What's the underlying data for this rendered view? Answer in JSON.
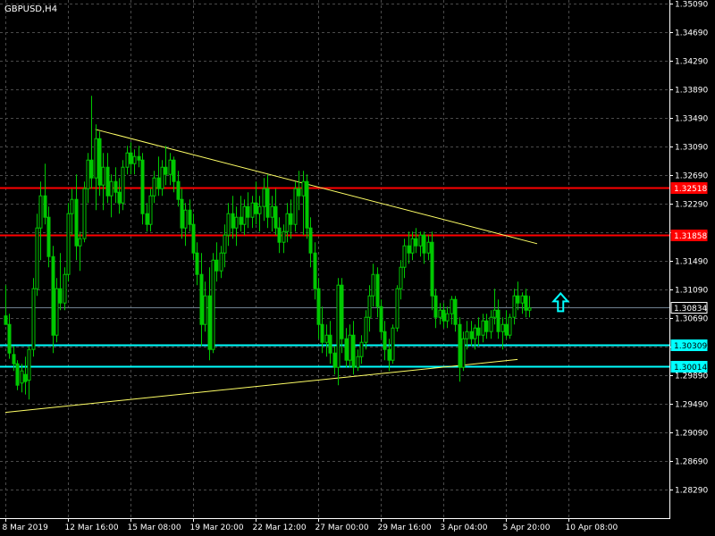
{
  "symbol_label": "GBPUSD,H4",
  "colors": {
    "background": "#000000",
    "grid": "#4a4a4a",
    "axis": "#ffffff",
    "candle": "#00c800",
    "resistance": "#ff0000",
    "support": "#00ffff",
    "trendline": "#ffff66",
    "current_price_line": "#708090"
  },
  "chart_data": {
    "type": "candlestick",
    "symbol": "GBPUSD",
    "timeframe": "H4",
    "title": "GBPUSD,H4",
    "ylim": [
      1.2809,
      1.3509
    ],
    "grid": true,
    "y_ticks": [
      "1.35090",
      "1.34690",
      "1.34290",
      "1.33890",
      "1.33490",
      "1.33090",
      "1.32690",
      "1.32290",
      "1.31890",
      "1.31490",
      "1.31090",
      "1.30690",
      "1.30290",
      "1.29890",
      "1.29490",
      "1.29090",
      "1.28690",
      "1.28290"
    ],
    "x_ticks": [
      "8 Mar 2019",
      "12 Mar 16:00",
      "15 Mar 08:00",
      "19 Mar 20:00",
      "22 Mar 12:00",
      "27 Mar 00:00",
      "29 Mar 16:00",
      "3 Apr 04:00",
      "5 Apr 20:00",
      "10 Apr 08:00"
    ],
    "x_range": [
      0,
      136
    ],
    "x_tick_index": [
      0,
      16,
      32,
      48,
      64,
      80,
      96,
      112,
      128,
      144
    ],
    "horizontal_levels": [
      {
        "name": "resistance-1",
        "price": 1.32518,
        "label": "1.32518",
        "color": "#ff0000"
      },
      {
        "name": "resistance-2",
        "price": 1.31858,
        "label": "1.31858",
        "color": "#ff0000"
      },
      {
        "name": "current-price",
        "price": 1.30834,
        "label": "1.30834",
        "color": "#708090"
      },
      {
        "name": "support-1",
        "price": 1.30309,
        "label": "1.30309",
        "color": "#00ffff"
      },
      {
        "name": "support-2",
        "price": 1.30014,
        "label": "1.30014",
        "color": "#00ffff"
      }
    ],
    "trendlines": [
      {
        "name": "descending-trendline",
        "from": [
          23,
          1.3333
        ],
        "to": [
          136,
          1.3173
        ]
      },
      {
        "name": "ascending-trendline",
        "from": [
          0,
          1.2937
        ],
        "to": [
          131,
          1.3011
        ]
      }
    ],
    "arrow": {
      "name": "up-arrow",
      "x": 142,
      "price": 1.3091,
      "direction": "up",
      "color": "#00ffff"
    },
    "candles": [
      [
        1.3072,
        1.3115,
        1.3065,
        1.306
      ],
      [
        1.306,
        1.3075,
        1.3012,
        1.302
      ],
      [
        1.3018,
        1.303,
        1.2995,
        1.3005
      ],
      [
        1.3005,
        1.301,
        1.2968,
        1.2975
      ],
      [
        1.2978,
        1.3005,
        1.2965,
        1.2995
      ],
      [
        1.299,
        1.3015,
        1.2962,
        1.298
      ],
      [
        1.2982,
        1.303,
        1.2955,
        1.3025
      ],
      [
        1.3025,
        1.3125,
        1.3015,
        1.311
      ],
      [
        1.311,
        1.3215,
        1.31,
        1.3195
      ],
      [
        1.3195,
        1.326,
        1.315,
        1.324
      ],
      [
        1.324,
        1.3285,
        1.32,
        1.321
      ],
      [
        1.321,
        1.3225,
        1.314,
        1.3155
      ],
      [
        1.3155,
        1.317,
        1.302,
        1.3045
      ],
      [
        1.3045,
        1.3125,
        1.3035,
        1.311
      ],
      [
        1.311,
        1.316,
        1.308,
        1.309
      ],
      [
        1.309,
        1.314,
        1.308,
        1.313
      ],
      [
        1.313,
        1.323,
        1.312,
        1.3215
      ],
      [
        1.3215,
        1.325,
        1.3185,
        1.3235
      ],
      [
        1.3235,
        1.327,
        1.315,
        1.317
      ],
      [
        1.317,
        1.319,
        1.3135,
        1.318
      ],
      [
        1.318,
        1.326,
        1.3175,
        1.325
      ],
      [
        1.325,
        1.33,
        1.323,
        1.329
      ],
      [
        1.329,
        1.338,
        1.325,
        1.3265
      ],
      [
        1.3265,
        1.334,
        1.322,
        1.332
      ],
      [
        1.332,
        1.333,
        1.324,
        1.3255
      ],
      [
        1.3255,
        1.33,
        1.322,
        1.328
      ],
      [
        1.328,
        1.33,
        1.323,
        1.324
      ],
      [
        1.324,
        1.327,
        1.321,
        1.326
      ],
      [
        1.326,
        1.328,
        1.323,
        1.3245
      ],
      [
        1.3245,
        1.3265,
        1.3215,
        1.323
      ],
      [
        1.323,
        1.329,
        1.322,
        1.328
      ],
      [
        1.328,
        1.331,
        1.327,
        1.33
      ],
      [
        1.33,
        1.3315,
        1.327,
        1.3285
      ],
      [
        1.3285,
        1.3305,
        1.327,
        1.3295
      ],
      [
        1.3295,
        1.331,
        1.328,
        1.329
      ],
      [
        1.329,
        1.33,
        1.32,
        1.3215
      ],
      [
        1.3215,
        1.323,
        1.319,
        1.32
      ],
      [
        1.32,
        1.325,
        1.319,
        1.324
      ],
      [
        1.324,
        1.3275,
        1.323,
        1.3265
      ],
      [
        1.3265,
        1.3295,
        1.324,
        1.325
      ],
      [
        1.325,
        1.329,
        1.324,
        1.328
      ],
      [
        1.328,
        1.331,
        1.3255,
        1.327
      ],
      [
        1.327,
        1.33,
        1.3255,
        1.329
      ],
      [
        1.329,
        1.3295,
        1.3245,
        1.326
      ],
      [
        1.326,
        1.3275,
        1.3225,
        1.3235
      ],
      [
        1.3235,
        1.325,
        1.318,
        1.3195
      ],
      [
        1.3195,
        1.323,
        1.317,
        1.322
      ],
      [
        1.322,
        1.3235,
        1.319,
        1.32
      ],
      [
        1.32,
        1.3215,
        1.315,
        1.316
      ],
      [
        1.316,
        1.3175,
        1.3115,
        1.313
      ],
      [
        1.313,
        1.316,
        1.303,
        1.306
      ],
      [
        1.306,
        1.312,
        1.305,
        1.31
      ],
      [
        1.31,
        1.314,
        1.301,
        1.3025
      ],
      [
        1.3025,
        1.316,
        1.302,
        1.315
      ],
      [
        1.315,
        1.3175,
        1.312,
        1.3135
      ],
      [
        1.3135,
        1.317,
        1.3125,
        1.316
      ],
      [
        1.316,
        1.32,
        1.314,
        1.3185
      ],
      [
        1.3185,
        1.323,
        1.317,
        1.3215
      ],
      [
        1.3215,
        1.324,
        1.318,
        1.3195
      ],
      [
        1.3195,
        1.3225,
        1.317,
        1.321
      ],
      [
        1.321,
        1.324,
        1.319,
        1.32
      ],
      [
        1.32,
        1.3235,
        1.3185,
        1.3225
      ],
      [
        1.3225,
        1.3245,
        1.3195,
        1.321
      ],
      [
        1.321,
        1.324,
        1.3195,
        1.323
      ],
      [
        1.323,
        1.326,
        1.32,
        1.3215
      ],
      [
        1.3215,
        1.324,
        1.319,
        1.3225
      ],
      [
        1.3225,
        1.3265,
        1.3205,
        1.325
      ],
      [
        1.325,
        1.327,
        1.3195,
        1.321
      ],
      [
        1.321,
        1.324,
        1.319,
        1.3225
      ],
      [
        1.3225,
        1.325,
        1.3185,
        1.3195
      ],
      [
        1.3195,
        1.321,
        1.316,
        1.3175
      ],
      [
        1.3175,
        1.32,
        1.316,
        1.319
      ],
      [
        1.319,
        1.323,
        1.3175,
        1.3215
      ],
      [
        1.3215,
        1.3235,
        1.318,
        1.32
      ],
      [
        1.32,
        1.326,
        1.319,
        1.325
      ],
      [
        1.325,
        1.3275,
        1.322,
        1.324
      ],
      [
        1.324,
        1.3275,
        1.3185,
        1.326
      ],
      [
        1.326,
        1.327,
        1.318,
        1.3195
      ],
      [
        1.3195,
        1.321,
        1.314,
        1.316
      ],
      [
        1.316,
        1.3175,
        1.3095,
        1.311
      ],
      [
        1.311,
        1.3125,
        1.304,
        1.306
      ],
      [
        1.306,
        1.3085,
        1.302,
        1.3035
      ],
      [
        1.3035,
        1.306,
        1.3015,
        1.3045
      ],
      [
        1.3045,
        1.3065,
        1.3005,
        1.302
      ],
      [
        1.302,
        1.303,
        1.299,
        1.3
      ],
      [
        1.3,
        1.3125,
        1.2975,
        1.3115
      ],
      [
        1.3115,
        1.3125,
        1.302,
        1.304
      ],
      [
        1.304,
        1.3055,
        1.3,
        1.301
      ],
      [
        1.301,
        1.306,
        1.3,
        1.3045
      ],
      [
        1.3045,
        1.3065,
        1.299,
        1.3
      ],
      [
        1.3,
        1.3025,
        1.2995,
        1.3015
      ],
      [
        1.3015,
        1.3045,
        1.3005,
        1.3035
      ],
      [
        1.3035,
        1.308,
        1.3025,
        1.307
      ],
      [
        1.307,
        1.3115,
        1.305,
        1.31
      ],
      [
        1.31,
        1.3145,
        1.3085,
        1.313
      ],
      [
        1.313,
        1.314,
        1.307,
        1.3085
      ],
      [
        1.3085,
        1.3095,
        1.304,
        1.305
      ],
      [
        1.305,
        1.3065,
        1.301,
        1.3025
      ],
      [
        1.3025,
        1.304,
        1.2995,
        1.301
      ],
      [
        1.301,
        1.306,
        1.3005,
        1.3055
      ],
      [
        1.3055,
        1.3115,
        1.305,
        1.311
      ],
      [
        1.311,
        1.315,
        1.3095,
        1.314
      ],
      [
        1.314,
        1.318,
        1.3125,
        1.317
      ],
      [
        1.317,
        1.319,
        1.3145,
        1.316
      ],
      [
        1.316,
        1.319,
        1.315,
        1.318
      ],
      [
        1.318,
        1.3195,
        1.316,
        1.317
      ],
      [
        1.317,
        1.319,
        1.3155,
        1.3185
      ],
      [
        1.3185,
        1.319,
        1.3145,
        1.316
      ],
      [
        1.316,
        1.3185,
        1.315,
        1.3175
      ],
      [
        1.3175,
        1.319,
        1.308,
        1.31
      ],
      [
        1.31,
        1.311,
        1.3055,
        1.307
      ],
      [
        1.307,
        1.309,
        1.306,
        1.308
      ],
      [
        1.308,
        1.309,
        1.3055,
        1.3065
      ],
      [
        1.3065,
        1.3085,
        1.3055,
        1.3075
      ],
      [
        1.3075,
        1.31,
        1.306,
        1.3095
      ],
      [
        1.3095,
        1.31,
        1.305,
        1.306
      ],
      [
        1.306,
        1.307,
        1.298,
        1.3
      ],
      [
        1.3,
        1.305,
        1.2995,
        1.304
      ],
      [
        1.304,
        1.3065,
        1.3025,
        1.305
      ],
      [
        1.305,
        1.3065,
        1.303,
        1.304
      ],
      [
        1.304,
        1.306,
        1.3025,
        1.3055
      ],
      [
        1.3055,
        1.307,
        1.303,
        1.3045
      ],
      [
        1.3045,
        1.3075,
        1.3035,
        1.3065
      ],
      [
        1.3065,
        1.3075,
        1.304,
        1.305
      ],
      [
        1.305,
        1.308,
        1.304,
        1.307
      ],
      [
        1.307,
        1.311,
        1.306,
        1.308
      ],
      [
        1.308,
        1.3095,
        1.304,
        1.305
      ],
      [
        1.305,
        1.307,
        1.3025,
        1.306
      ],
      [
        1.306,
        1.308,
        1.304,
        1.3045
      ],
      [
        1.3045,
        1.3075,
        1.304,
        1.307
      ],
      [
        1.307,
        1.311,
        1.306,
        1.31
      ],
      [
        1.31,
        1.312,
        1.308,
        1.309
      ],
      [
        1.309,
        1.3105,
        1.3075,
        1.31
      ],
      [
        1.31,
        1.311,
        1.307,
        1.308
      ],
      [
        1.308,
        1.31,
        1.307,
        1.3083
      ]
    ]
  }
}
